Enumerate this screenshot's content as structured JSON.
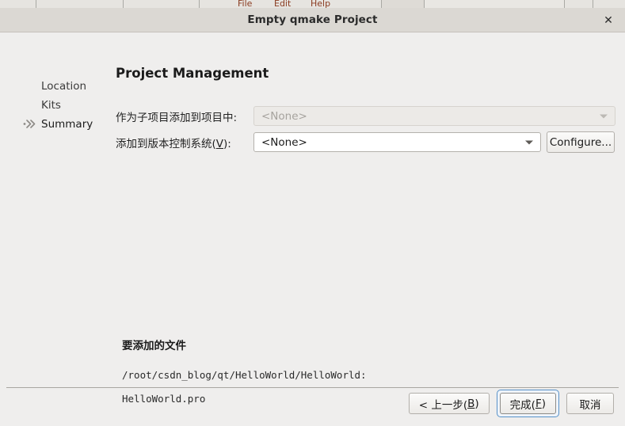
{
  "window": {
    "title": "Empty qmake Project",
    "close_icon": "close-icon"
  },
  "background": {
    "menu_items": [
      "File",
      "Edit",
      "Help"
    ]
  },
  "sidebar": {
    "items": [
      {
        "label": "Location",
        "current": false,
        "marker": ""
      },
      {
        "label": "Kits",
        "current": false,
        "marker": ""
      },
      {
        "label": "Summary",
        "current": true,
        "marker": "double-chevron-right-icon"
      }
    ]
  },
  "page": {
    "title": "Project Management",
    "fields": [
      {
        "label": "作为子项目添加到项目中:",
        "mnemonic": "",
        "value": "<None>",
        "enabled": false
      },
      {
        "label_prefix": "添加到版本控制系统(",
        "mnemonic": "V",
        "label_suffix": "):",
        "value": "<None>",
        "enabled": true
      }
    ],
    "configure_button": "Configure..."
  },
  "files": {
    "heading": "要添加的文件",
    "lines": [
      "/root/csdn_blog/qt/HelloWorld/HelloWorld:",
      "HelloWorld.pro"
    ]
  },
  "footer": {
    "back": {
      "prefix": "< 上一步(",
      "mnemonic": "B",
      "suffix": ")"
    },
    "finish": {
      "prefix": "完成(",
      "mnemonic": "F",
      "suffix": ")",
      "focused": true
    },
    "cancel": {
      "label": "取消"
    }
  },
  "colors": {
    "titlebar": "#dbd8d3",
    "body": "#efeeed",
    "focus_ring": "#5791c8",
    "menu_text": "#8a3b20"
  }
}
